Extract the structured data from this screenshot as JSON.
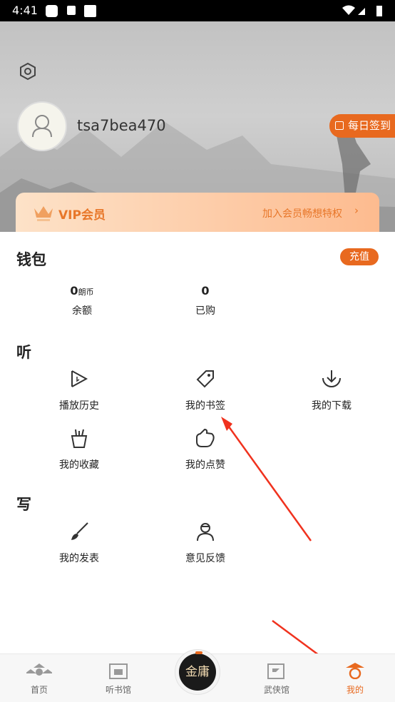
{
  "status_bar": {
    "time": "4:41"
  },
  "profile": {
    "username": "tsa7bea470",
    "checkin_label": "每日签到"
  },
  "vip": {
    "title": "VIP会员",
    "cta": "加入会员畅想特权"
  },
  "wallet": {
    "title": "钱包",
    "recharge": "充值",
    "balance_value": "0",
    "balance_unit": "朗币",
    "balance_label": "余额",
    "purchased_value": "0",
    "purchased_label": "已购"
  },
  "listen": {
    "title": "听",
    "items": [
      {
        "label": "播放历史"
      },
      {
        "label": "我的书签"
      },
      {
        "label": "我的下载"
      },
      {
        "label": "我的收藏"
      },
      {
        "label": "我的点赞"
      }
    ]
  },
  "write": {
    "title": "写",
    "items": [
      {
        "label": "我的发表"
      },
      {
        "label": "意见反馈"
      }
    ]
  },
  "bottom_nav": {
    "items": [
      {
        "label": "首页"
      },
      {
        "label": "听书馆"
      },
      {
        "label": "武侠馆"
      },
      {
        "label": "我的"
      }
    ],
    "center_logo_text": "金庸",
    "active": "我的"
  },
  "colors": {
    "accent": "#e8691f",
    "vip_text": "#e8772a",
    "annotation_arrow": "#f0321e"
  }
}
